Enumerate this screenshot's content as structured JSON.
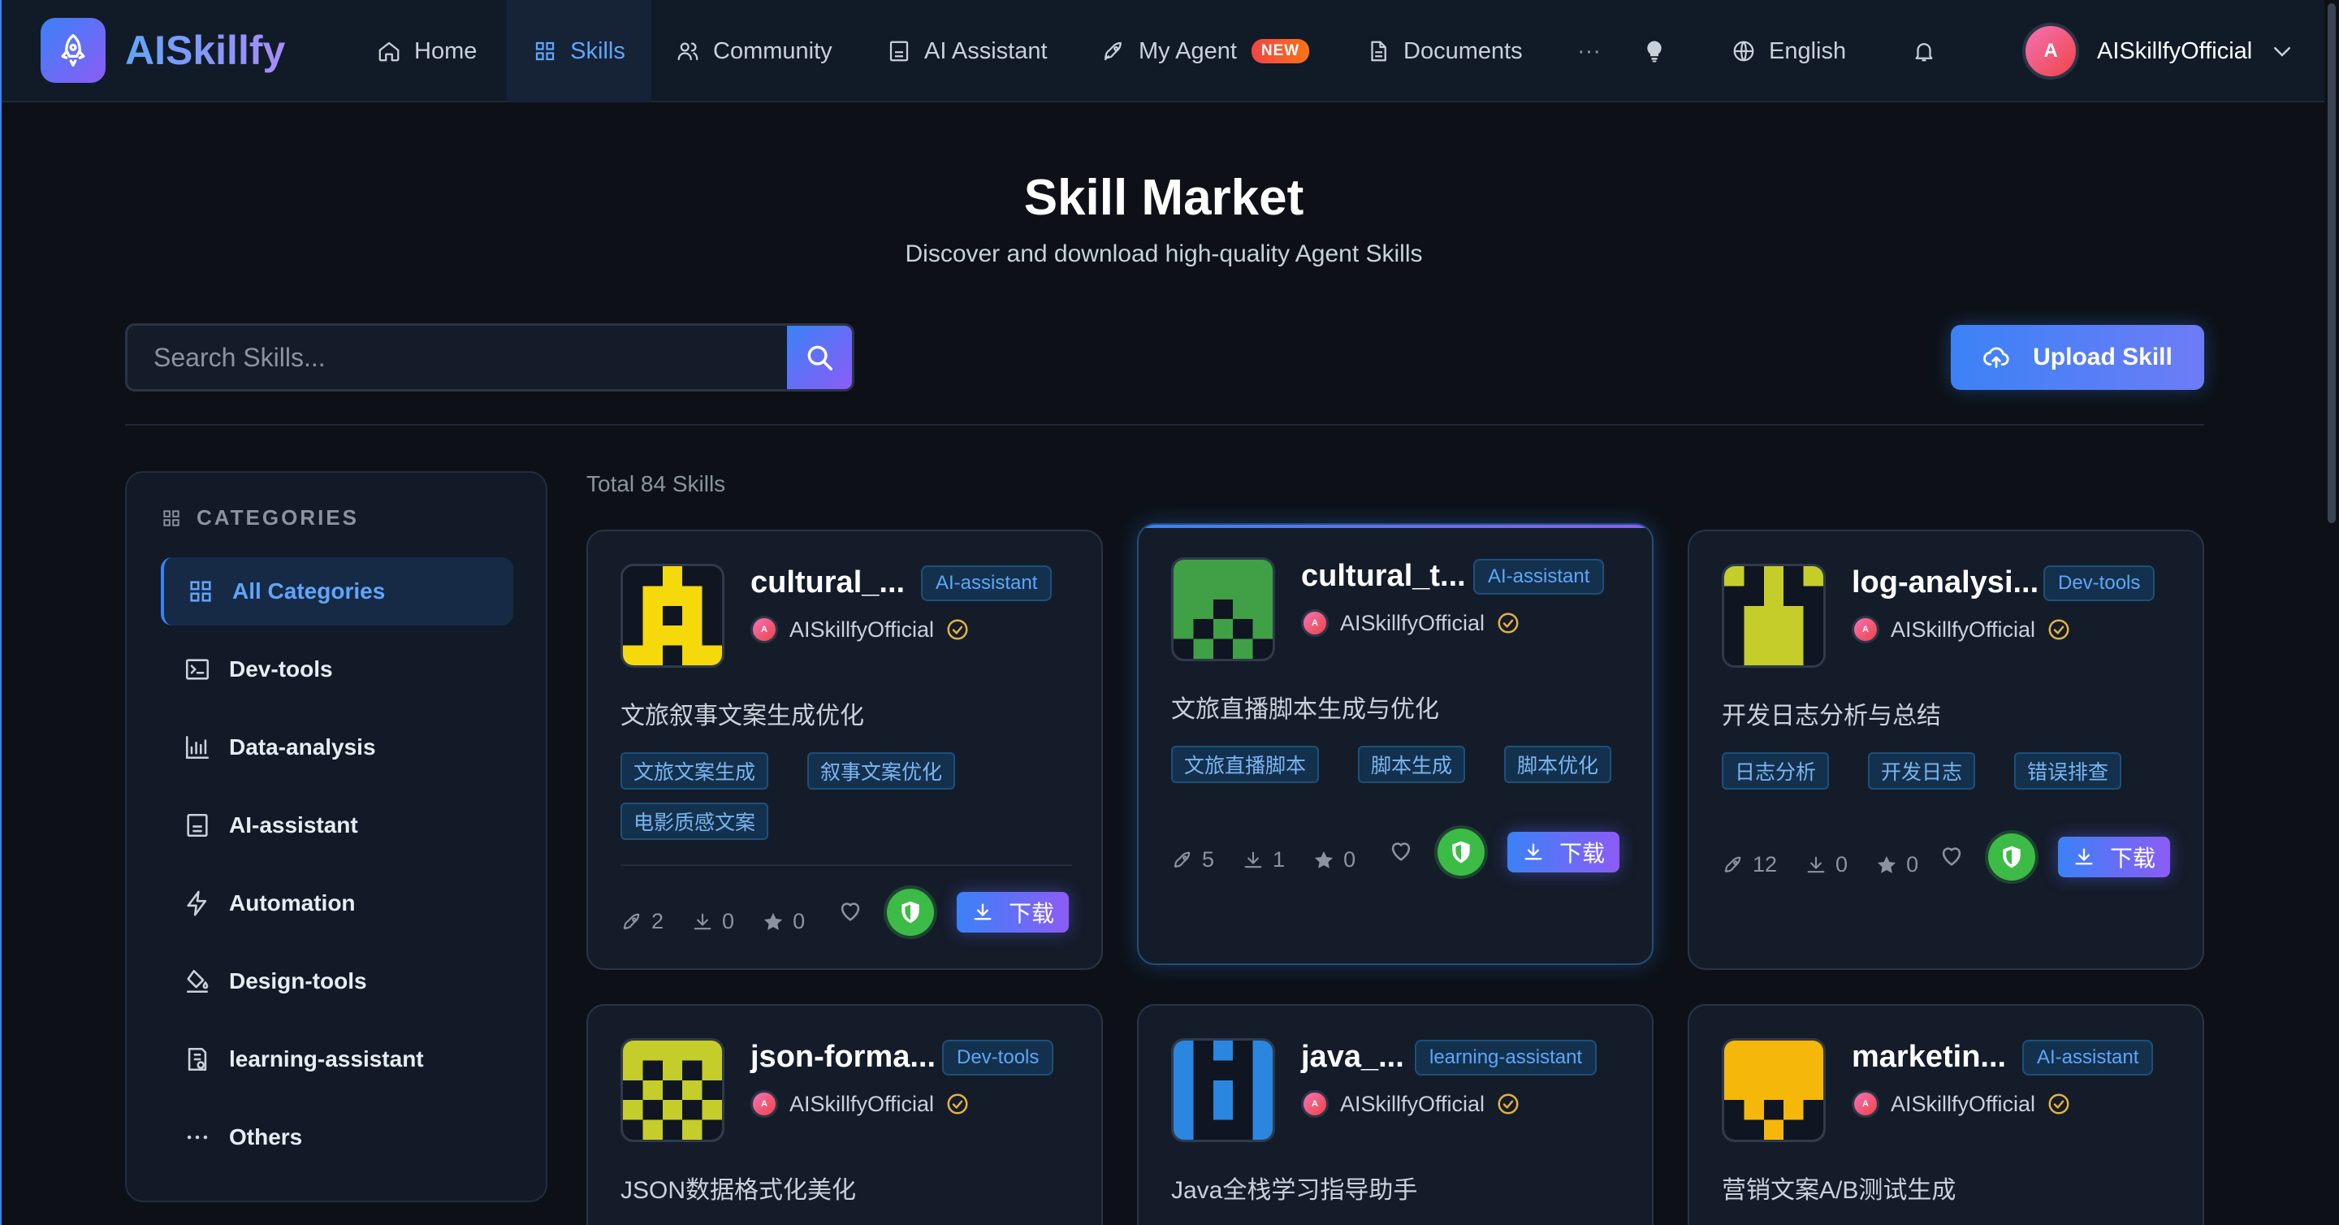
{
  "brand": {
    "name": "AISkillfy"
  },
  "nav": {
    "items": [
      {
        "label": "Home"
      },
      {
        "label": "Skills"
      },
      {
        "label": "Community"
      },
      {
        "label": "AI Assistant"
      },
      {
        "label": "My Agent",
        "badge": "NEW"
      },
      {
        "label": "Documents"
      }
    ],
    "more": "···",
    "language": "English",
    "user": {
      "name": "AISkillfyOfficial",
      "initial": "A"
    }
  },
  "header": {
    "title": "Skill Market",
    "subtitle": "Discover and download high-quality Agent Skills"
  },
  "search": {
    "placeholder": "Search Skills..."
  },
  "upload": {
    "label": "Upload Skill"
  },
  "sidebar": {
    "heading": "CATEGORIES",
    "items": [
      {
        "label": "All Categories",
        "icon": "grid-icon"
      },
      {
        "label": "Dev-tools",
        "icon": "terminal-icon"
      },
      {
        "label": "Data-analysis",
        "icon": "bar-chart-icon"
      },
      {
        "label": "AI-assistant",
        "icon": "robot-icon"
      },
      {
        "label": "Automation",
        "icon": "lightning-icon"
      },
      {
        "label": "Design-tools",
        "icon": "paint-bucket-icon"
      },
      {
        "label": "learning-assistant",
        "icon": "book-icon"
      },
      {
        "label": "Others",
        "icon": "ellipsis-icon"
      }
    ]
  },
  "market": {
    "total": "Total 84 Skills",
    "download_label": "下载",
    "cards": [
      {
        "name": "cultural_...",
        "category": "AI-assistant",
        "author": "AISkillfyOfficial",
        "description": "文旅叙事文案生成优化",
        "tags": [
          "文旅文案生成",
          "叙事文案优化",
          "电影质感文案"
        ],
        "stats": {
          "links": "2",
          "downloads": "0",
          "stars": "0"
        },
        "icon_color": "#f5d90a"
      },
      {
        "name": "cultural_t...",
        "category": "AI-assistant",
        "author": "AISkillfyOfficial",
        "description": "文旅直播脚本生成与优化",
        "tags": [
          "文旅直播脚本",
          "脚本生成",
          "脚本优化"
        ],
        "stats": {
          "links": "5",
          "downloads": "1",
          "stars": "0"
        },
        "icon_color": "#3fa046"
      },
      {
        "name": "log-analysi...",
        "category": "Dev-tools",
        "author": "AISkillfyOfficial",
        "description": "开发日志分析与总结",
        "tags": [
          "日志分析",
          "开发日志",
          "错误排查"
        ],
        "stats": {
          "links": "12",
          "downloads": "0",
          "stars": "0"
        },
        "icon_color": "#c5cd2a"
      },
      {
        "name": "json-forma...",
        "category": "Dev-tools",
        "author": "AISkillfyOfficial",
        "description": "JSON数据格式化美化",
        "icon_color": "#c5cd2a"
      },
      {
        "name": "java_...",
        "category": "learning-assistant",
        "author": "AISkillfyOfficial",
        "description": "Java全栈学习指导助手",
        "icon_color": "#2b86e0"
      },
      {
        "name": "marketin...",
        "category": "AI-assistant",
        "author": "AISkillfyOfficial",
        "description": "营销文案A/B测试生成",
        "icon_color": "#f5b70a"
      }
    ]
  }
}
